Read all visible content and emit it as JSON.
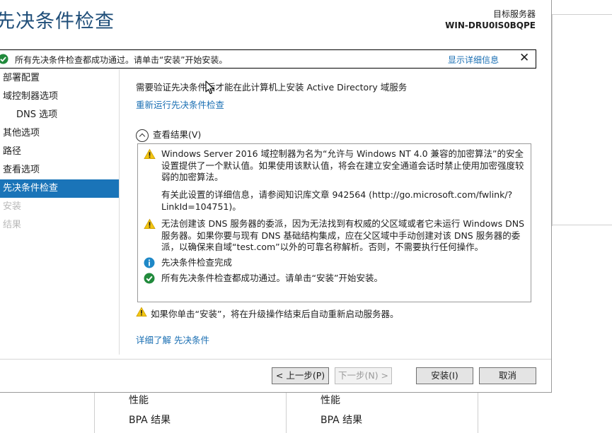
{
  "background": {
    "tiles": [
      {
        "label_1": "性能",
        "label_2": "BPA 结果"
      },
      {
        "label_1": "性能",
        "label_2": "BPA 结果"
      }
    ]
  },
  "wizard": {
    "title": "先决条件检查",
    "target_label": "目标服务器",
    "target_name": "WIN-DRU0IS0BQPE"
  },
  "notice": {
    "text": "所有先决条件检查都成功通过。请单击“安装”开始安装。",
    "details_link": "显示详细信息",
    "close": "✕"
  },
  "nav": {
    "items": [
      {
        "label": "部署配置",
        "state": "normal"
      },
      {
        "label": "域控制器选项",
        "state": "normal"
      },
      {
        "label": "DNS 选项",
        "state": "normal"
      },
      {
        "label": "其他选项",
        "state": "normal"
      },
      {
        "label": "路径",
        "state": "normal"
      },
      {
        "label": "查看选项",
        "state": "normal"
      },
      {
        "label": "先决条件检查",
        "state": "active"
      },
      {
        "label": "安装",
        "state": "disabled"
      },
      {
        "label": "结果",
        "state": "disabled"
      }
    ]
  },
  "content": {
    "intro": "需要验证先决条件后才能在此计算机上安装 Active Directory 域服务",
    "rerun_link": "重新运行先决条件检查",
    "view_results": "查看结果(V)",
    "results": [
      {
        "icon": "warning-icon",
        "text": "Windows Server 2016 域控制器为名为“允许与 Windows NT 4.0 兼容的加密算法”的安全设置提供了一个默认值。如果使用该默认值，将会在建立安全通道会话时禁止使用加密强度较弱的加密算法。"
      },
      {
        "icon": "none",
        "text": "有关此设置的详细信息，请参阅知识库文章 942564 (http://go.microsoft.com/fwlink/?LinkId=104751)。"
      },
      {
        "icon": "warning-icon",
        "text": "无法创建该 DNS 服务器的委派，因为无法找到有权威的父区域或者它未运行 Windows DNS 服务器。如果你要与现有 DNS 基础结构集成，应在父区域中手动创建对该 DNS 服务器的委派，以确保来自域“test.com”以外的可靠名称解析。否则，不需要执行任何操作。"
      },
      {
        "icon": "info-icon",
        "text": "先决条件检查完成"
      },
      {
        "icon": "success-icon",
        "text": "所有先决条件检查都成功通过。请单击“安装”开始安装。"
      }
    ],
    "restart_warning": "如果你单击“安装”，将在升级操作结束后自动重新启动服务器。",
    "more_link": "详细了解 先决条件"
  },
  "buttons": {
    "prev": "< 上一步(P)",
    "next": "下一步(N) >",
    "install": "安装(I)",
    "cancel": "取消"
  },
  "colors": {
    "accent": "#1a74b8",
    "link": "#1a6fb3",
    "title": "#1f4e79",
    "warning": "#f2c511",
    "info": "#1e88c7",
    "success": "#218a3c"
  }
}
